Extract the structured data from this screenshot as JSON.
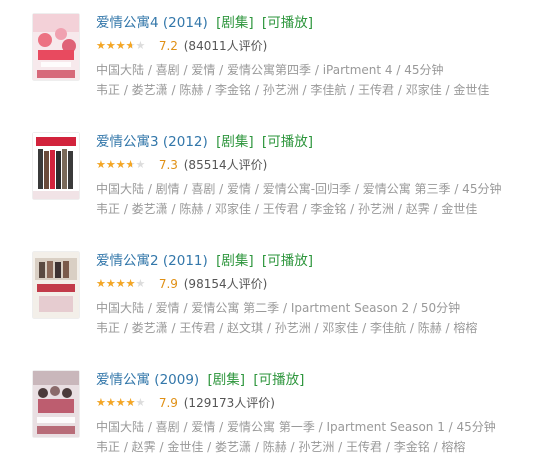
{
  "results": [
    {
      "title": "爱情公寓4",
      "year": "(2014)",
      "tag_type": "[剧集]",
      "tag_play": "[可播放]",
      "rating_fraction": 0.72,
      "score": "7.2",
      "votes": "(84011人评价)",
      "meta1": "中国大陆 / 喜剧 / 爱情 / 爱情公寓第四季 / iPartment 4 / 45分钟",
      "meta2": "韦正 / 娄艺潇 / 陈赫 / 李金铭 / 孙艺洲 / 李佳航 / 王传君 / 邓家佳 / 金世佳",
      "poster_colors": [
        "#f5e6e8",
        "#e84a5f",
        "#2a2a2a"
      ]
    },
    {
      "title": "爱情公寓3",
      "year": "(2012)",
      "tag_type": "[剧集]",
      "tag_play": "[可播放]",
      "rating_fraction": 0.73,
      "score": "7.3",
      "votes": "(85514人评价)",
      "meta1": "中国大陆 / 剧情 / 喜剧 / 爱情 / 爱情公寓-回归季 / 爱情公寓 第三季 / 45分钟",
      "meta2": "韦正 / 娄艺潇 / 陈赫 / 邓家佳 / 王传君 / 李金铭 / 孙艺洲 / 赵霁 / 金世佳",
      "poster_colors": [
        "#ffffff",
        "#d2233c",
        "#333333"
      ]
    },
    {
      "title": "爱情公寓2",
      "year": "(2011)",
      "tag_type": "[剧集]",
      "tag_play": "[可播放]",
      "rating_fraction": 0.79,
      "score": "7.9",
      "votes": "(98154人评价)",
      "meta1": "中国大陆 / 爱情 / 爱情公寓 第二季 / Ipartment Season 2 / 50分钟",
      "meta2": "韦正 / 娄艺潇 / 王传君 / 赵文琪 / 孙艺洲 / 邓家佳 / 李佳航 / 陈赫 / 榕榕",
      "poster_colors": [
        "#f3efe9",
        "#c23b4a",
        "#5a4a42"
      ]
    },
    {
      "title": "爱情公寓",
      "year": "(2009)",
      "tag_type": "[剧集]",
      "tag_play": "[可播放]",
      "rating_fraction": 0.79,
      "score": "7.9",
      "votes": "(129173人评价)",
      "meta1": "中国大陆 / 喜剧 / 爱情 / 爱情公寓 第一季 / Ipartment Season 1 / 45分钟",
      "meta2": "韦正 / 赵霁 / 金世佳 / 娄艺潇 / 陈赫 / 孙艺洲 / 王传君 / 李金铭 / 榕榕",
      "poster_colors": [
        "#e9dfe2",
        "#b5475a",
        "#4a3a3a"
      ]
    }
  ],
  "star_glyphs": "★★★★★",
  "colors": {
    "link": "#3377aa",
    "tag": "#2e963d",
    "star": "#f5a623",
    "meta": "#999999"
  }
}
